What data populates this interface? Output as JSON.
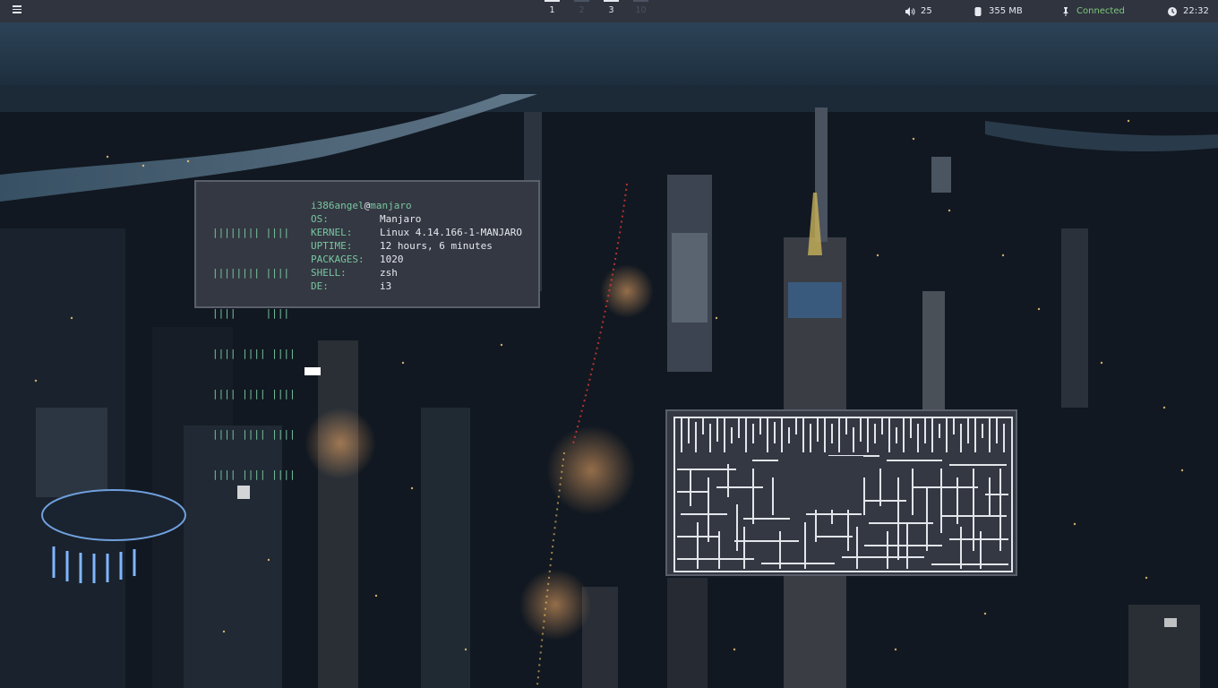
{
  "topbar": {
    "workspaces": [
      {
        "label": "1",
        "state": "active"
      },
      {
        "label": "2",
        "state": "dim"
      },
      {
        "label": "3",
        "state": "active"
      },
      {
        "label": "10",
        "state": "dim"
      }
    ],
    "volume": "25",
    "memory": "355 MB",
    "network": "Connected",
    "clock": "22:32",
    "colors": {
      "bar_bg": "#2f343f",
      "text": "#e6e9ef",
      "connected": "#7ec77b"
    }
  },
  "neofetch": {
    "user": "i386angel",
    "at": "@",
    "host": "manjaro",
    "logo_lines": [
      "|||||||| ||||",
      "|||||||| ||||",
      "||||     ||||",
      "|||| |||| ||||",
      "|||| |||| ||||",
      "|||| |||| ||||",
      "|||| |||| ||||"
    ],
    "rows": [
      {
        "key": "OS:",
        "value": "Manjaro"
      },
      {
        "key": "KERNEL:",
        "value": "Linux 4.14.166-1-MANJARO"
      },
      {
        "key": "UPTIME:",
        "value": "12 hours, 6 minutes"
      },
      {
        "key": "PACKAGES:",
        "value": "1020"
      },
      {
        "key": "SHELL:",
        "value": "zsh"
      },
      {
        "key": "DE:",
        "value": "i3"
      }
    ],
    "accent": "#78c6a0"
  },
  "icons": {
    "menu": "hamburger-icon",
    "volume": "speaker-icon",
    "memory": "memory-chip-icon",
    "network": "pin-icon",
    "clock": "clock-icon"
  }
}
